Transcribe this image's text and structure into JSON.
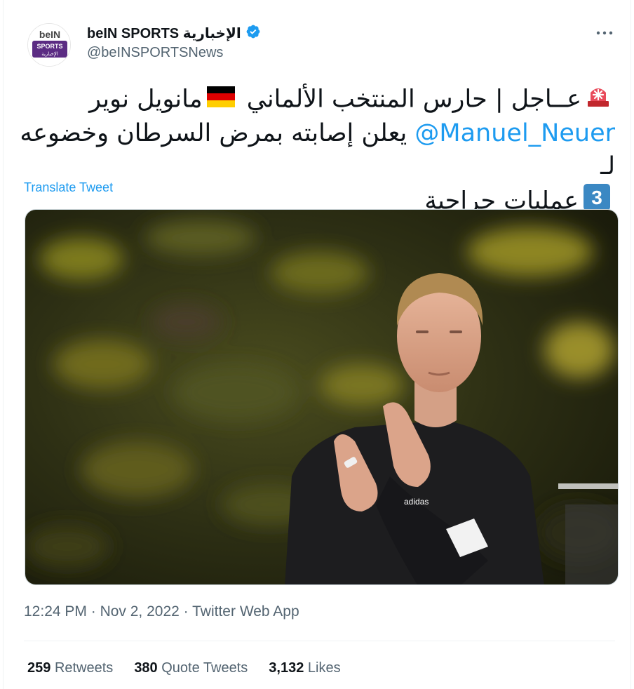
{
  "account": {
    "name": "beIN SPORTS الإخبارية",
    "handle": "@beINSPORTSNews",
    "verified": true,
    "avatar_logo_text": "beIN SPORTS الإخبارية"
  },
  "tweet": {
    "line1": "عــاجل | حارس المنتخب الألماني",
    "line1_end": "مانويل نوير",
    "mention": "@Manuel_Neuer",
    "line2": "يعلن إصابته بمرض السرطان وخضوعه لـ",
    "number_emoji": "3",
    "line3": "عمليات جراحية",
    "emojis": [
      "rotating-light-icon",
      "germany-flag-icon",
      "keycap-3-icon"
    ]
  },
  "translate_label": "Translate Tweet",
  "meta": {
    "time": "12:24 PM",
    "date": "Nov 2, 2022",
    "source": "Twitter Web App",
    "separator": "·"
  },
  "stats": {
    "retweets_count": "259",
    "retweets_label": "Retweets",
    "quotes_count": "380",
    "quotes_label": "Quote Tweets",
    "likes_count": "3,132",
    "likes_label": "Likes"
  },
  "colors": {
    "link": "#1d9bf0",
    "secondary_text": "#536471",
    "primary_text": "#0f1419",
    "brand_purple": "#5b2c83"
  }
}
